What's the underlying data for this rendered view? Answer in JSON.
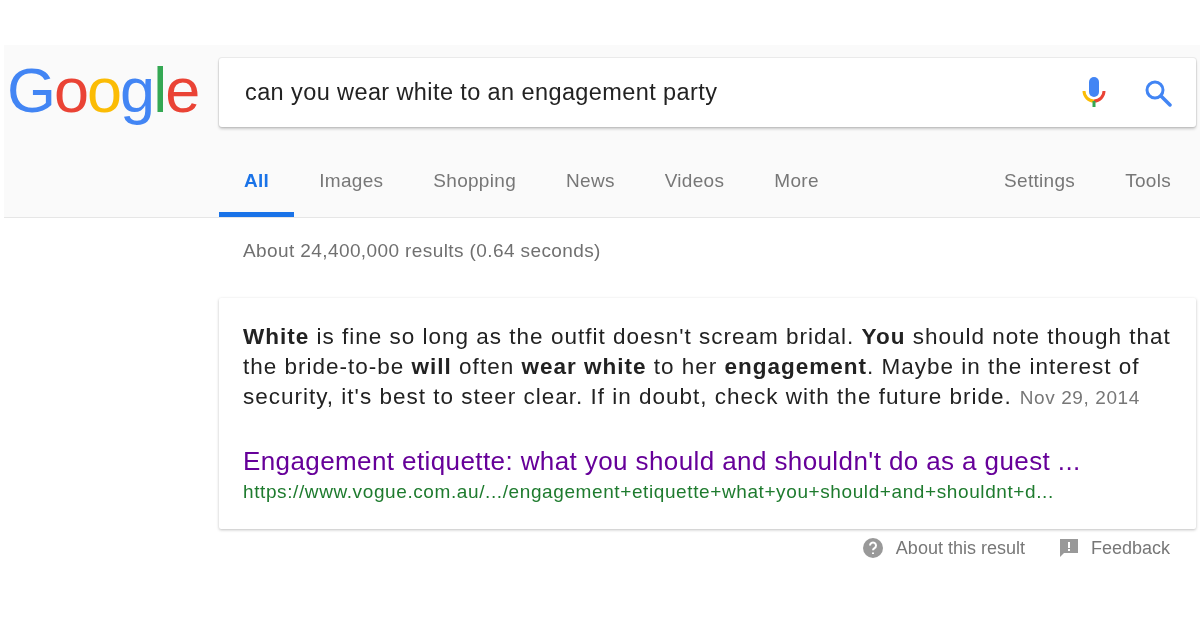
{
  "logo": "Google",
  "search": {
    "value": "can you wear white to an engagement party"
  },
  "tabs": [
    {
      "label": "All",
      "selected": true
    },
    {
      "label": "Images",
      "selected": false
    },
    {
      "label": "Shopping",
      "selected": false
    },
    {
      "label": "News",
      "selected": false
    },
    {
      "label": "Videos",
      "selected": false
    },
    {
      "label": "More",
      "selected": false
    }
  ],
  "tools": [
    "Settings",
    "Tools"
  ],
  "result_stats": "About 24,400,000 results (0.64 seconds)",
  "featured_snippet": {
    "text": "**White** is fine so long as the outfit doesn't scream bridal. **You** should note though that the bride-to-be **will** often **wear white** to her **engagement**. Maybe in the interest of security, it's best to steer clear. If in doubt, check with the future bride.",
    "date": "Nov 29, 2014",
    "title": "Engagement etiquette: what you should and shouldn't do as a guest ...",
    "url": "https://www.vogue.com.au/.../engagement+etiquette+what+you+should+and+shouldnt+d..."
  },
  "footer_links": [
    "About this result",
    "Feedback"
  ]
}
